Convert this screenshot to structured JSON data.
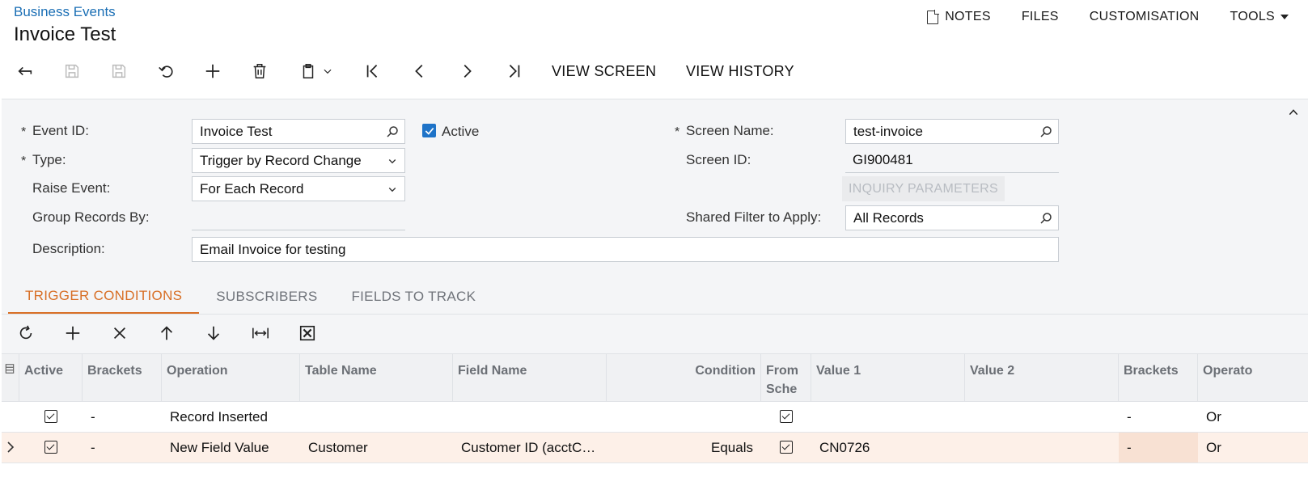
{
  "header": {
    "breadcrumb": "Business Events",
    "title": "Invoice Test",
    "menu": {
      "notes": "NOTES",
      "files": "FILES",
      "customisation": "CUSTOMISATION",
      "tools": "TOOLS"
    }
  },
  "toolbar": {
    "view_screen": "VIEW SCREEN",
    "view_history": "VIEW HISTORY"
  },
  "form": {
    "event_id_label": "Event ID:",
    "event_id_value": "Invoice Test",
    "active_label": "Active",
    "type_label": "Type:",
    "type_value": "Trigger by Record Change",
    "raise_event_label": "Raise Event:",
    "raise_event_value": "For Each Record",
    "group_records_label": "Group Records By:",
    "group_records_value": "",
    "description_label": "Description:",
    "description_value": "Email Invoice for testing",
    "screen_name_label": "Screen Name:",
    "screen_name_value": "test-invoice",
    "screen_id_label": "Screen ID:",
    "screen_id_value": "GI900481",
    "inquiry_parameters": "INQUIRY PARAMETERS",
    "shared_filter_label": "Shared Filter to Apply:",
    "shared_filter_value": "All Records",
    "required_marker": "*"
  },
  "tabs": [
    "TRIGGER CONDITIONS",
    "SUBSCRIBERS",
    "FIELDS TO TRACK"
  ],
  "grid": {
    "columns": {
      "active": "Active",
      "brackets": "Brackets",
      "operation": "Operation",
      "table_name": "Table Name",
      "field_name": "Field Name",
      "condition": "Condition",
      "from_schema_1": "From",
      "from_schema_2": "Sche",
      "value1": "Value 1",
      "value2": "Value 2",
      "brackets2": "Brackets",
      "operator": "Operato"
    },
    "rows": [
      {
        "active": true,
        "brackets": "-",
        "operation": "Record Inserted",
        "table_name": "",
        "field_name": "",
        "condition": "",
        "from_schema": true,
        "value1": "",
        "value2": "",
        "brackets2": "-",
        "operator": "Or"
      },
      {
        "active": true,
        "brackets": "-",
        "operation": "New Field Value",
        "table_name": "Customer",
        "field_name": "Customer ID (acctC…",
        "condition": "Equals",
        "from_schema": true,
        "value1": "CN0726",
        "value2": "",
        "brackets2": "-",
        "operator": "Or"
      }
    ]
  },
  "colors": {
    "link": "#1b6fb5",
    "accent": "#d86f26",
    "checkbox": "#1e73c8",
    "selected_row": "#fdf0e8"
  }
}
